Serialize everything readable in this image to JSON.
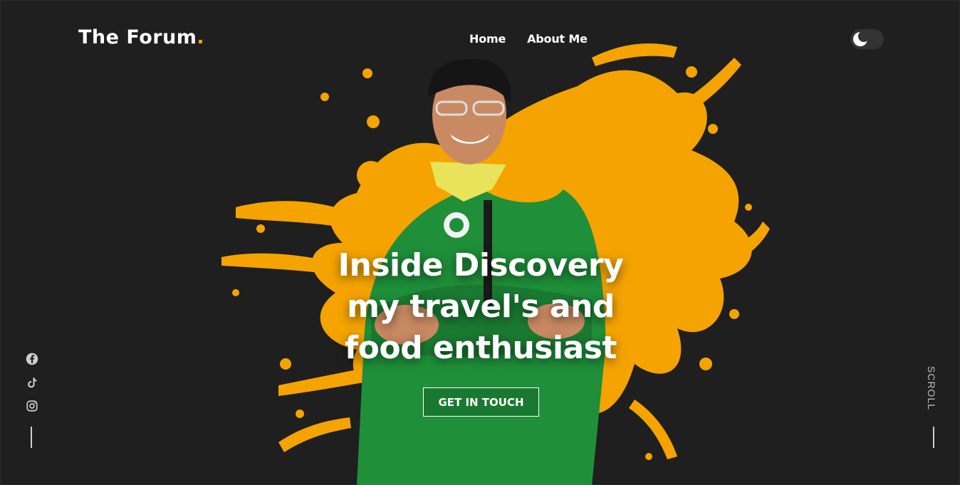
{
  "header": {
    "logo_text": "The Forum",
    "logo_dot": ".",
    "nav": [
      {
        "label": "Home"
      },
      {
        "label": "About Me"
      }
    ],
    "theme_toggle_icon": "moon-icon"
  },
  "hero": {
    "headline_lines": [
      "Inside Discovery",
      "my travel's and",
      "food enthusiast"
    ],
    "cta_label": "GET IN TOUCH",
    "image_description_icon": "profile-photo"
  },
  "socials": [
    {
      "icon": "facebook-icon"
    },
    {
      "icon": "tiktok-icon"
    },
    {
      "icon": "instagram-icon"
    }
  ],
  "scroll_label": "SCROLL",
  "colors": {
    "background": "#1f1f1f",
    "accent": "#f5a300",
    "text": "#ffffff",
    "shirt": "#1f8f3a"
  }
}
